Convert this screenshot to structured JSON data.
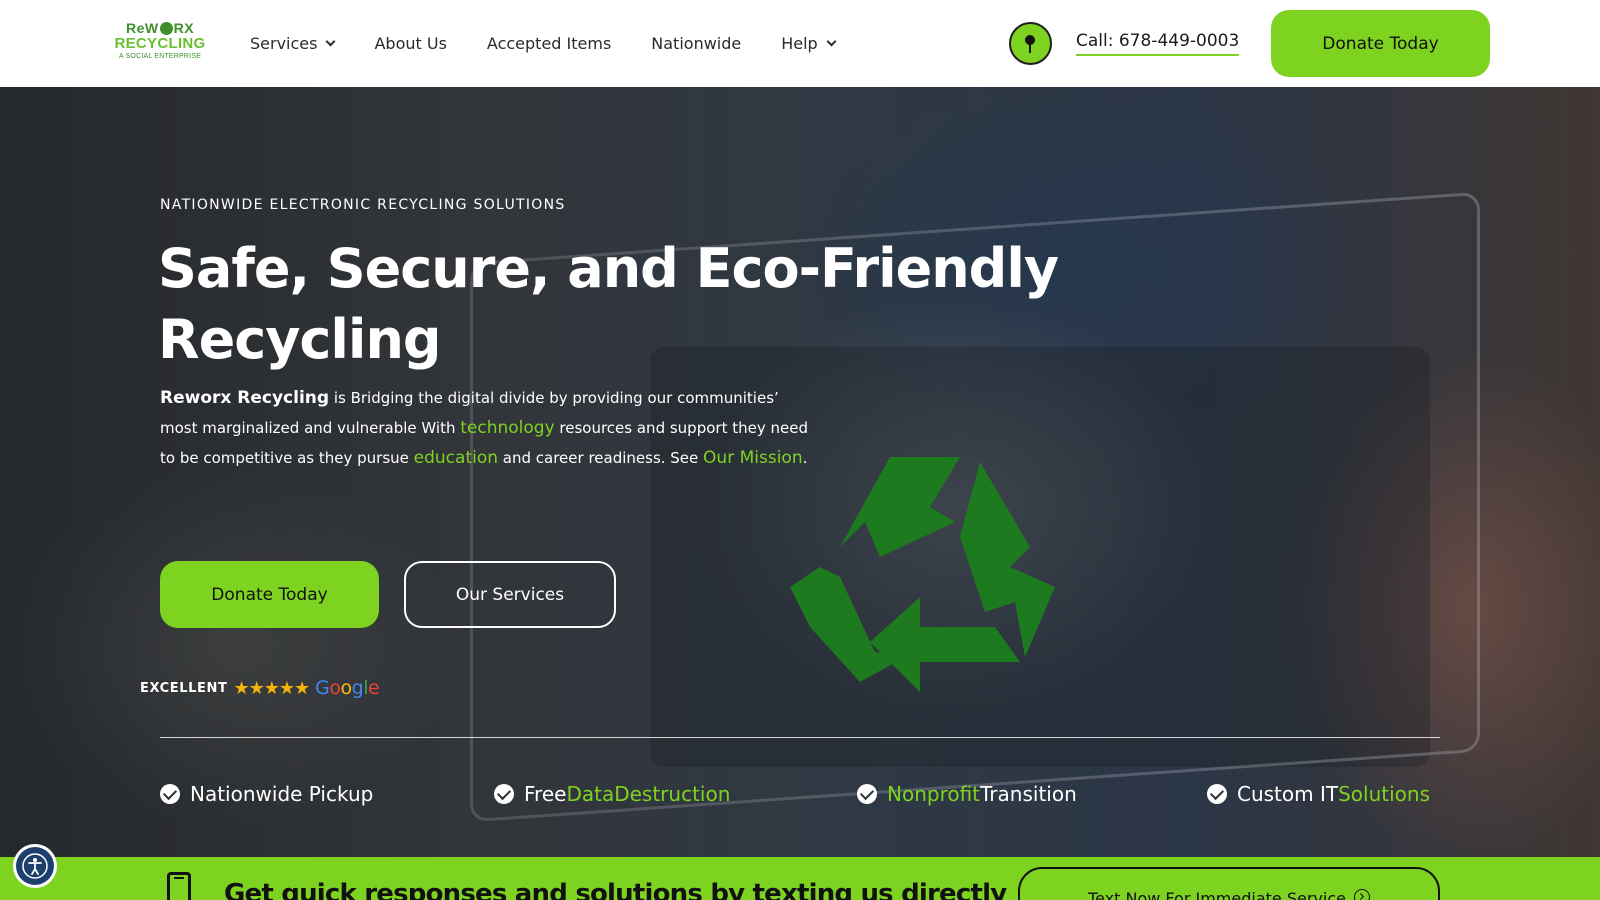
{
  "header": {
    "logo": {
      "line1": "ReW",
      "line1b": "RX",
      "line2": "RECYCLING",
      "line3": "A SOCIAL ENTERPRISE"
    },
    "nav": [
      {
        "label": "Services",
        "has_dropdown": true
      },
      {
        "label": "About Us",
        "has_dropdown": false
      },
      {
        "label": "Accepted Items",
        "has_dropdown": false
      },
      {
        "label": "Nationwide",
        "has_dropdown": false
      },
      {
        "label": "Help",
        "has_dropdown": true
      }
    ],
    "location_icon": "map-pin-icon",
    "call_label": "Call: 678-449-0003",
    "donate_label": "Donate Today"
  },
  "hero": {
    "eyebrow": "NATIONWIDE ELECTRONIC RECYCLING SOLUTIONS",
    "headline_line1": "Safe, Secure, and Eco-Friendly",
    "headline_line2": "Recycling",
    "paragraph": {
      "brand": "Reworx Recycling",
      "p1": " is Bridging the digital divide by providing our communities’ most marginalized and vulnerable With ",
      "link_technology": "technology",
      "p2": " resources and support they need to be competitive as they pursue ",
      "link_education": "education",
      "p3": " and career readiness. See ",
      "link_mission": "Our Mission",
      "p4": "."
    },
    "donate_button": "Donate Today",
    "services_button": "Our Services",
    "rating": {
      "label": "EXCELLENT",
      "stars": 5,
      "stars_text": "★★★★★",
      "provider": "Google"
    },
    "features": [
      {
        "plain": "Nationwide Pickup",
        "highlight": ""
      },
      {
        "plain": "Free ",
        "highlight": "DataDestruction"
      },
      {
        "highlight": "Nonprofit",
        "plain": " Transition"
      },
      {
        "plain": "Custom IT ",
        "highlight": "Solutions"
      }
    ]
  },
  "bottom_bar": {
    "text": "Get quick responses and solutions by texting us directly",
    "button": "Text Now For Immediate Service"
  },
  "colors": {
    "accent": "#7ed321",
    "brand_dark_green": "#3f8f2c",
    "star": "#f6b40a",
    "recycle_symbol": "#1e7a1e"
  }
}
